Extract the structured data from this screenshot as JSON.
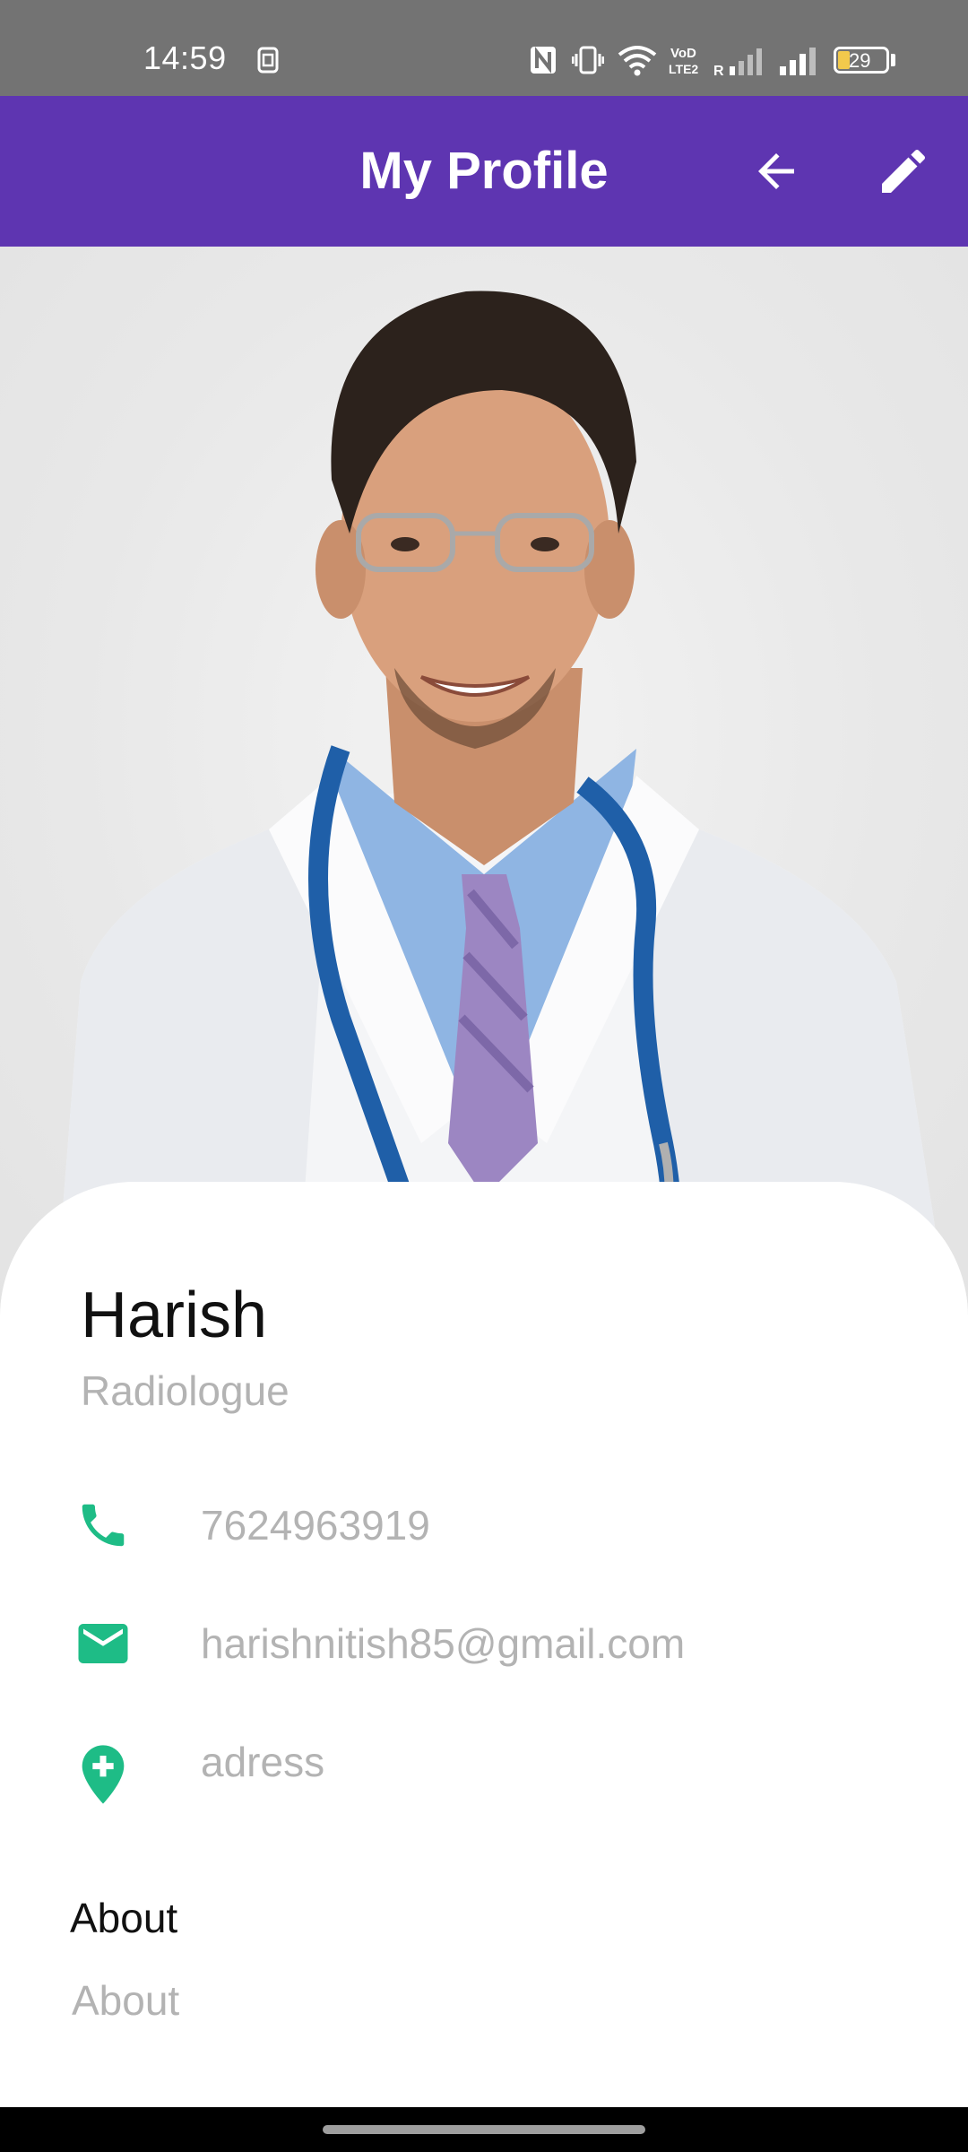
{
  "status_bar": {
    "time": "14:59",
    "battery_level": "29",
    "icons": [
      "sim-icon",
      "nfc-icon",
      "vibrate-icon",
      "wifi-icon",
      "volte-icon",
      "signal-icon",
      "signal-icon",
      "battery-icon"
    ]
  },
  "app_bar": {
    "title": "My Profile",
    "back_icon": "arrow-back-icon",
    "edit_icon": "edit-pencil-icon",
    "background": "#5e35b1"
  },
  "profile": {
    "photo": "doctor-portrait-photo",
    "name": "Harish",
    "role": "Radiologue",
    "phone": "7624963919",
    "email": "harishnitish85@gmail.com",
    "address": "adress",
    "about_title": "About",
    "about_text": "About",
    "accent_color": "#1ebc86"
  }
}
